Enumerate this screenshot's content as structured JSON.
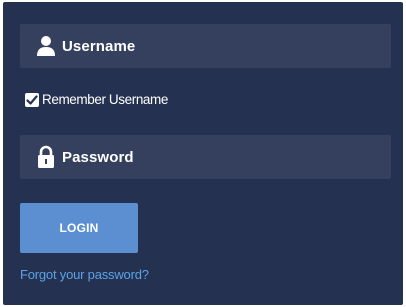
{
  "login_form": {
    "username": {
      "placeholder": "Username",
      "icon": "user-icon"
    },
    "remember": {
      "label": "Remember Username",
      "checked": true
    },
    "password": {
      "placeholder": "Password",
      "icon": "lock-icon"
    },
    "login_label": "LOGIN",
    "forgot_label": "Forgot your password?"
  },
  "colors": {
    "panel_background": "#253150",
    "field_background": "#34405e",
    "button_background": "#5b8fd1",
    "link": "#5ba3e6",
    "text": "#ffffff"
  }
}
